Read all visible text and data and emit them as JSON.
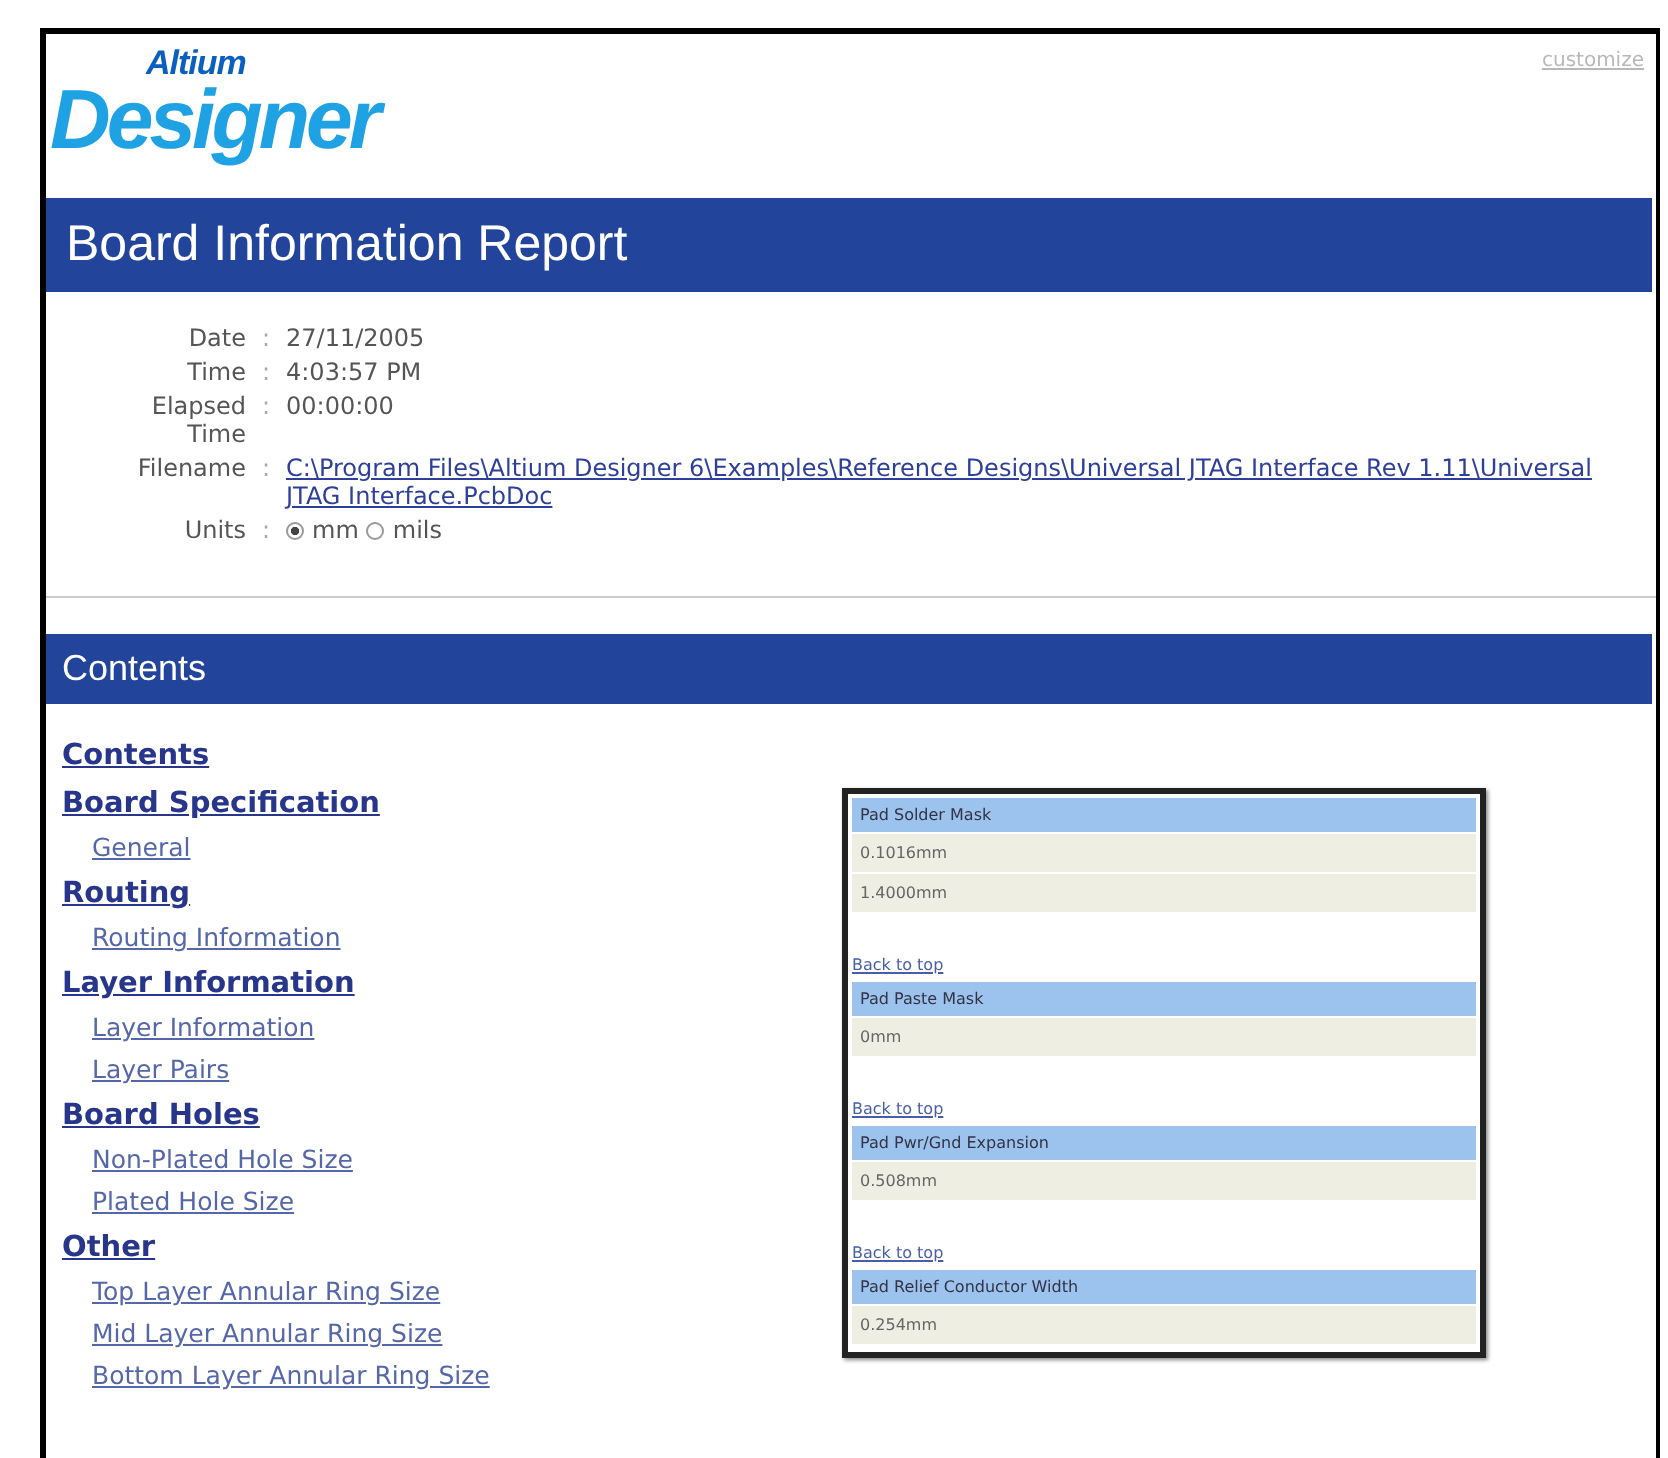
{
  "logo": {
    "top": "Altium",
    "bottom": "Designer"
  },
  "customize_link": "customize",
  "title": "Board Information Report",
  "info": [
    {
      "label": "Date",
      "separator": ":",
      "value": "27/11/2005",
      "kind": "text"
    },
    {
      "label": "Time",
      "separator": ":",
      "value": "4:03:57 PM",
      "kind": "text"
    },
    {
      "label": "Elapsed Time",
      "separator": ":",
      "value": "00:00:00",
      "kind": "text"
    },
    {
      "label": "Filename",
      "separator": ":",
      "value": "C:\\Program Files\\Altium Designer 6\\Examples\\Reference Designs\\Universal JTAG Interface Rev 1.11\\Universal JTAG Interface.PcbDoc",
      "kind": "link"
    },
    {
      "label": "Units",
      "separator": ":",
      "kind": "radio",
      "options": [
        {
          "label": "mm",
          "selected": true
        },
        {
          "label": "mils",
          "selected": false
        }
      ]
    }
  ],
  "contents_title": "Contents",
  "contents": [
    {
      "label": "Contents"
    },
    {
      "label": "Board Specification",
      "children": [
        {
          "label": "General"
        }
      ]
    },
    {
      "label": "Routing",
      "children": [
        {
          "label": "Routing Information"
        }
      ]
    },
    {
      "label": "Layer Information",
      "children": [
        {
          "label": "Layer Information"
        },
        {
          "label": "Layer Pairs"
        }
      ]
    },
    {
      "label": "Board Holes",
      "children": [
        {
          "label": "Non-Plated Hole Size"
        },
        {
          "label": "Plated Hole Size"
        }
      ]
    },
    {
      "label": "Other",
      "children": [
        {
          "label": "Top Layer Annular Ring Size"
        },
        {
          "label": "Mid Layer Annular Ring Size"
        },
        {
          "label": "Bottom Layer Annular Ring Size"
        }
      ]
    }
  ],
  "inset": [
    {
      "heading": "Pad Solder Mask",
      "values": [
        "0.1016mm",
        "1.4000mm"
      ],
      "back_link": "Back to top"
    },
    {
      "heading": "Pad Paste Mask",
      "values": [
        "0mm"
      ],
      "back_link": "Back to top"
    },
    {
      "heading": "Pad Pwr/Gnd Expansion",
      "values": [
        "0.508mm"
      ],
      "back_link": "Back to top"
    },
    {
      "heading": "Pad Relief Conductor Width",
      "values": [
        "0.254mm"
      ]
    }
  ]
}
